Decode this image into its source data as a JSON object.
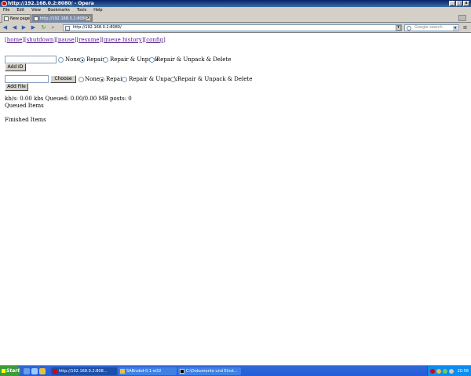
{
  "window": {
    "title": "http://192.168.0.2:8080/ - Opera",
    "btn_min": "_",
    "btn_max": "□",
    "btn_close": "x"
  },
  "menu": [
    "File",
    "Edit",
    "View",
    "Bookmarks",
    "Tools",
    "Help"
  ],
  "tabs": {
    "new_page": "New page",
    "active": "http://192.168.0.2:8080/",
    "close": "x"
  },
  "nav": {
    "address": "http://192.168.0.2:8080/",
    "search_placeholder": "Google search",
    "dropdown": "▾"
  },
  "page": {
    "nav_open": "[",
    "nav_close": "]",
    "links": [
      "home",
      "shutdown",
      "pause",
      "resume",
      "queue history",
      "config"
    ],
    "sep": "][",
    "form1": {
      "opt_none": "None",
      "opt_repair": "Repair",
      "opt_repair_unpack": "Repair & Unpack",
      "opt_repair_unpack_delete": "Repair & Unpack & Delete",
      "selected": "Repair",
      "submit": "Add ID"
    },
    "form2": {
      "choose": "Choose",
      "opt_none": "None",
      "opt_repair": "Repair",
      "opt_repair_unpack": "Repair & Unpack",
      "opt_repair_unpack_delete": "Repair & Unpack & Delete",
      "selected": "Repair",
      "submit": "Add File"
    },
    "status": "kb/s: 0.00 kbs Queued: 0.00/0.00 MB posts: 0",
    "queued_heading": "Queued Items",
    "finished_heading": "Finished Items"
  },
  "taskbar": {
    "start": "Start",
    "tasks": [
      "http://192.168.0.2:808...",
      "SABnzbd-0.1-w32",
      "C:\\Dokumente und Einst..."
    ],
    "clock": "20:58"
  }
}
